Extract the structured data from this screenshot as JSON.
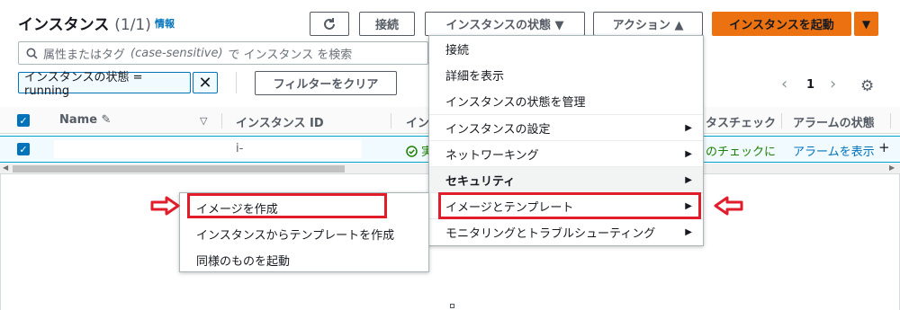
{
  "header": {
    "title": "インスタンス",
    "count": "(1/1)",
    "info": "情報",
    "refresh_icon": "refresh-icon",
    "connect_label": "接続",
    "instance_state_label": "インスタンスの状態 ▼",
    "actions_label": "アクション ▲",
    "launch_label": "インスタンスを起動",
    "launch_dropdown": "▼",
    "accent_color": "#ec7211"
  },
  "search": {
    "prefix": "属性またはタグ",
    "italic": "(case-sensitive)",
    "suffix": "で インスタンス を検索"
  },
  "filter": {
    "token": "インスタンスの状態 = running",
    "remove": "✕",
    "clear_label": "フィルターをクリア"
  },
  "pager": {
    "prev": "‹",
    "page": "1",
    "next": "›"
  },
  "table": {
    "columns": [
      "Name ✎",
      "▽",
      "インスタンス ID",
      "イン",
      "タスチェック",
      "アラームの状態"
    ],
    "row": {
      "instance_id": "i-",
      "state_icon": "check-circle-icon",
      "state": "実",
      "status_check": "のチェックに",
      "alarm_link": "アラームを表示",
      "alarm_add": "+"
    }
  },
  "actions_menu": {
    "items": [
      {
        "label": "接続",
        "has_sub": false
      },
      {
        "label": "詳細を表示",
        "has_sub": false
      },
      {
        "label": "インスタンスの状態を管理",
        "has_sub": false
      },
      {
        "label": "インスタンスの設定",
        "has_sub": true
      },
      {
        "label": "ネットワーキング",
        "has_sub": true
      },
      {
        "label": "セキュリティ",
        "has_sub": true
      },
      {
        "label": "イメージとテンプレート",
        "has_sub": true
      },
      {
        "label": "モニタリングとトラブルシューティング",
        "has_sub": true
      }
    ]
  },
  "image_submenu": {
    "items": [
      {
        "label": "イメージを作成"
      },
      {
        "label": "インスタンスからテンプレートを作成"
      },
      {
        "label": "同様のものを起動"
      }
    ]
  },
  "annotation_color": "#e11d2b"
}
